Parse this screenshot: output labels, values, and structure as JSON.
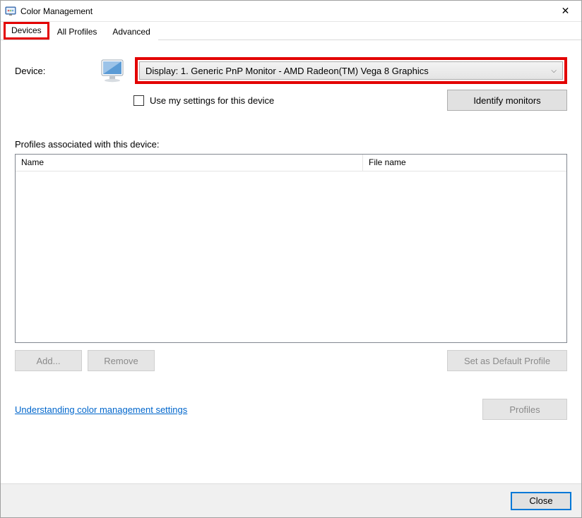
{
  "window": {
    "title": "Color Management"
  },
  "tabs": {
    "devices": "Devices",
    "all_profiles": "All Profiles",
    "advanced": "Advanced"
  },
  "device": {
    "label": "Device:",
    "value": "Display: 1. Generic PnP Monitor - AMD Radeon(TM) Vega 8 Graphics",
    "use_settings_label": "Use my settings for this device",
    "use_settings_checked": false,
    "identify_label": "Identify monitors"
  },
  "profiles": {
    "list_label": "Profiles associated with this device:",
    "columns": {
      "name": "Name",
      "file": "File name"
    },
    "items": []
  },
  "buttons": {
    "add": "Add...",
    "remove": "Remove",
    "set_default": "Set as Default Profile",
    "profiles_btn": "Profiles",
    "close": "Close"
  },
  "link": {
    "understanding": "Understanding color management settings"
  },
  "icons": {
    "app": "color-management-icon",
    "monitor": "monitor-icon",
    "close_x": "✕",
    "chevron": "⌵"
  }
}
